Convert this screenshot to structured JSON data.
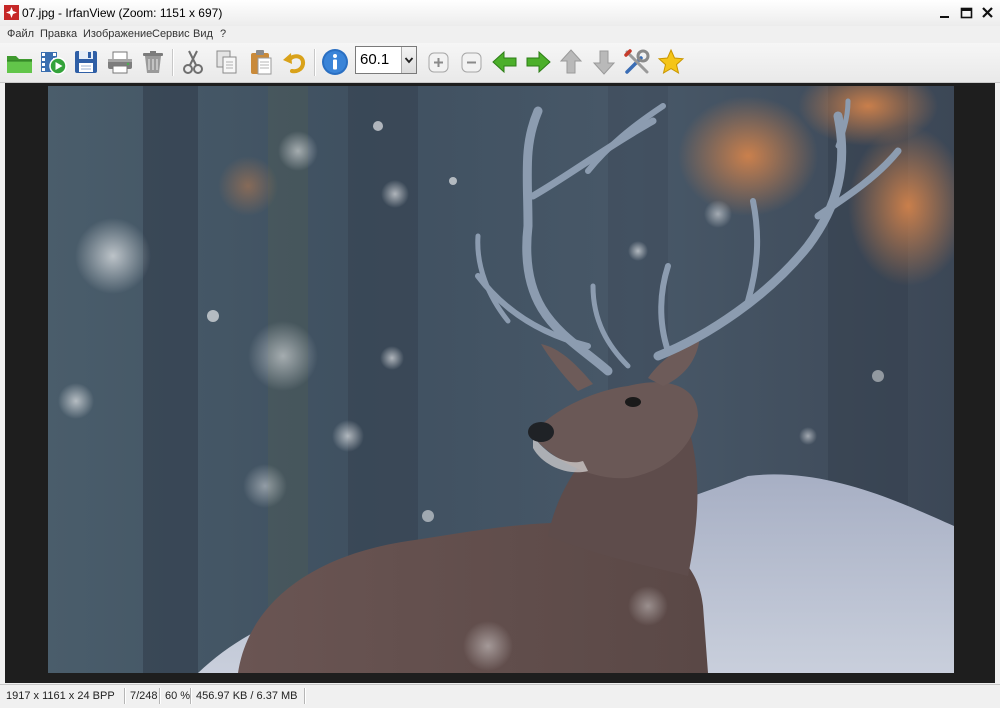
{
  "window": {
    "title": "07.jpg - IrfanView (Zoom: 1151 x 697)"
  },
  "menu": {
    "items": [
      "Файл",
      "Правка",
      "Изображение",
      "Сервис",
      "Вид",
      "?"
    ]
  },
  "toolbar": {
    "zoom_value": "60.1",
    "icons": [
      "open-folder",
      "slideshow",
      "save",
      "print",
      "delete",
      "cut",
      "copy",
      "paste",
      "undo",
      "info",
      "zoom-in",
      "zoom-out",
      "previous",
      "next",
      "first",
      "last",
      "settings",
      "favorite"
    ]
  },
  "status": {
    "dimensions": "1917 x 1161 x 24 BPP",
    "index": "7/248",
    "zoom": "60 %",
    "size": "456.97 KB / 6.37 MB"
  },
  "colors": {
    "frame": "#f0f0f0",
    "viewport": "#1e1e1e",
    "arrow_green": "#4caf2a",
    "arrow_gray": "#b9b9b9",
    "info_blue": "#2a6fc2"
  }
}
